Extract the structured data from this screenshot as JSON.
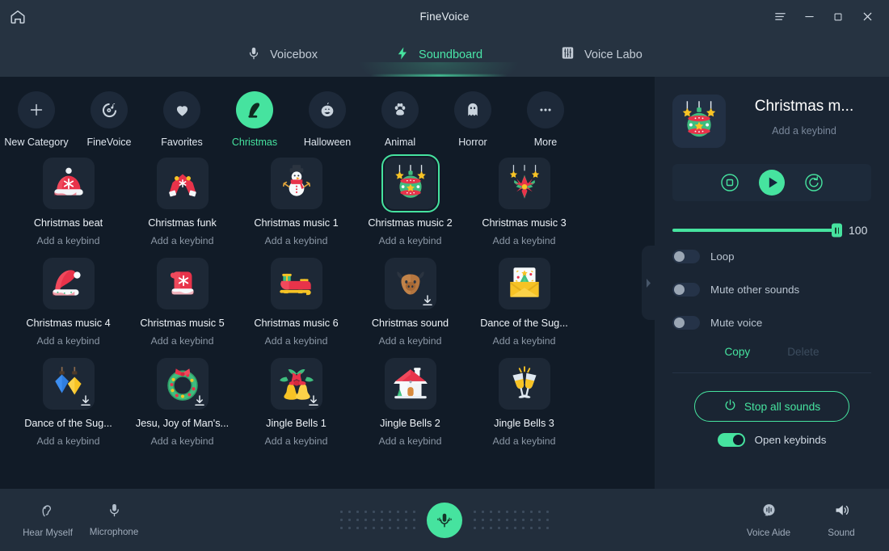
{
  "window": {
    "title": "FineVoice",
    "home_icon": "home-icon",
    "controls": [
      {
        "name": "menu-button",
        "icon": "hamburger-menu-icon"
      },
      {
        "name": "minimize-button",
        "icon": "minimize-icon"
      },
      {
        "name": "maximize-button",
        "icon": "maximize-icon"
      },
      {
        "name": "close-button",
        "icon": "close-icon"
      }
    ]
  },
  "tabs": [
    {
      "label": "Voicebox",
      "icon": "microphone-icon",
      "active": false
    },
    {
      "label": "Soundboard",
      "icon": "lightning-bolt-icon",
      "active": true
    },
    {
      "label": "Voice Labo",
      "icon": "equalizer-sliders-icon",
      "active": false
    }
  ],
  "categories": [
    {
      "label": "New Category",
      "icon": "plus-icon",
      "active": false
    },
    {
      "label": "FineVoice",
      "icon": "vinyl-note-icon",
      "active": false
    },
    {
      "label": "Favorites",
      "icon": "heart-icon",
      "active": false
    },
    {
      "label": "Christmas",
      "icon": "santa-hat-icon",
      "active": true
    },
    {
      "label": "Halloween",
      "icon": "pumpkin-icon",
      "active": false
    },
    {
      "label": "Animal",
      "icon": "paw-icon",
      "active": false
    },
    {
      "label": "Horror",
      "icon": "ghost-icon",
      "active": false
    },
    {
      "label": "More",
      "icon": "ellipsis-icon",
      "active": false
    }
  ],
  "keybind_placeholder": "Add a keybind",
  "sounds": [
    {
      "name": "Christmas beat",
      "keybind": "Add a keybind",
      "art": "santa-hat-snowflake",
      "selected": false,
      "downloadable": false
    },
    {
      "name": "Christmas funk",
      "keybind": "Add a keybind",
      "art": "scarf",
      "selected": false,
      "downloadable": false
    },
    {
      "name": "Christmas music 1",
      "keybind": "Add a keybind",
      "art": "snowman",
      "selected": false,
      "downloadable": false
    },
    {
      "name": "Christmas music 2",
      "keybind": "Add a keybind",
      "art": "bauble",
      "selected": true,
      "downloadable": false
    },
    {
      "name": "Christmas music 3",
      "keybind": "Add a keybind",
      "art": "poinsettia",
      "selected": false,
      "downloadable": false
    },
    {
      "name": "Christmas music 4",
      "keybind": "Add a keybind",
      "art": "santa-hat",
      "selected": false,
      "downloadable": false
    },
    {
      "name": "Christmas music 5",
      "keybind": "Add a keybind",
      "art": "mitten",
      "selected": false,
      "downloadable": false
    },
    {
      "name": "Christmas music 6",
      "keybind": "Add a keybind",
      "art": "sleigh",
      "selected": false,
      "downloadable": false
    },
    {
      "name": "Christmas sound",
      "keybind": "Add a keybind",
      "art": "reindeer",
      "selected": false,
      "downloadable": true
    },
    {
      "name": "Dance of the Sug...",
      "keybind": "Add a keybind",
      "art": "card-envelope",
      "selected": false,
      "downloadable": false
    },
    {
      "name": "Dance of the Sug...",
      "keybind": "Add a keybind",
      "art": "lanterns",
      "selected": false,
      "downloadable": true
    },
    {
      "name": "Jesu, Joy of Man's...",
      "keybind": "Add a keybind",
      "art": "wreath",
      "selected": false,
      "downloadable": true
    },
    {
      "name": "Jingle Bells 1",
      "keybind": "Add a keybind",
      "art": "bells",
      "selected": false,
      "downloadable": true
    },
    {
      "name": "Jingle Bells 2",
      "keybind": "Add a keybind",
      "art": "house",
      "selected": false,
      "downloadable": false
    },
    {
      "name": "Jingle Bells 3",
      "keybind": "Add a keybind",
      "art": "champagne",
      "selected": false,
      "downloadable": false
    }
  ],
  "panel": {
    "title": "Christmas m...",
    "keybind": "Add a keybind",
    "art": "bauble",
    "player": {
      "stop_label": "stop-button",
      "play_label": "play-button",
      "replay_label": "replay-button"
    },
    "volume": {
      "value": "100",
      "percent": 100
    },
    "toggles": [
      {
        "label": "Loop",
        "on": false
      },
      {
        "label": "Mute other sounds",
        "on": false
      },
      {
        "label": "Mute voice",
        "on": false
      }
    ],
    "copy_label": "Copy",
    "delete_label": "Delete",
    "stop_all_label": "Stop all sounds",
    "open_keybinds": {
      "label": "Open keybinds",
      "on": true
    }
  },
  "bottombar": {
    "left": [
      {
        "label": "Hear Myself",
        "icon": "ear-icon"
      },
      {
        "label": "Microphone",
        "icon": "microphone-icon"
      }
    ],
    "center": {
      "name": "mic-toggle-button",
      "icon": "microphone-icon"
    },
    "right": [
      {
        "label": "Voice Aide",
        "icon": "voice-aide-icon"
      },
      {
        "label": "Sound",
        "icon": "speaker-icon"
      }
    ]
  },
  "colors": {
    "accent": "#46e39f",
    "titlebar": "#263341",
    "main_bg": "#111b27",
    "panel_bg": "#1a2533",
    "bottombar": "#222e3c"
  }
}
